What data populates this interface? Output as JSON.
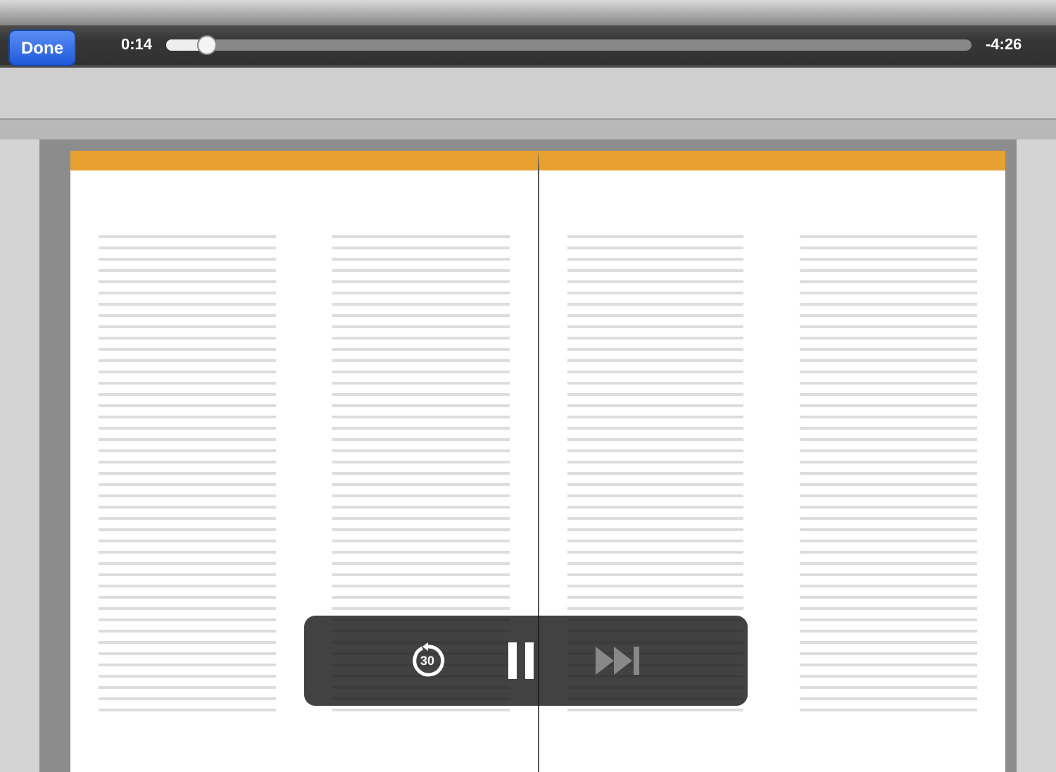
{
  "top_bar": {
    "done_button": "Done",
    "elapsed": "0:14",
    "remaining": "-4:26",
    "playback": {
      "level": 0.05
    }
  },
  "controls": {
    "rewind_label": "30",
    "playing": true,
    "forward_disabled": true
  }
}
